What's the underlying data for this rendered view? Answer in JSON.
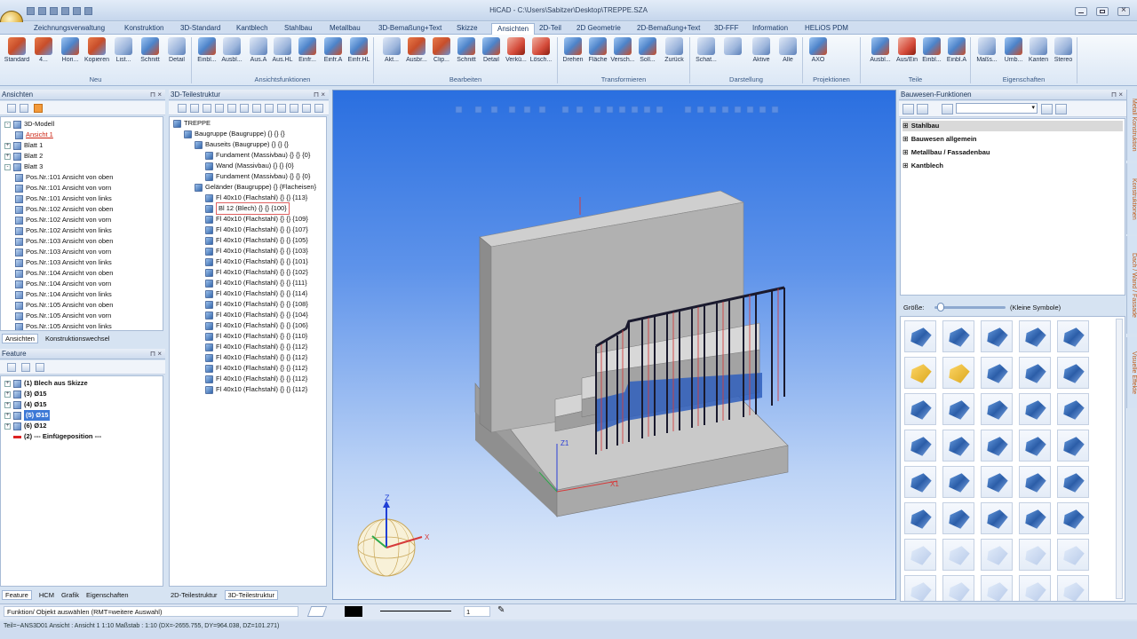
{
  "window": {
    "title": "HiCAD - C:\\Users\\Sabitzer\\Desktop\\TREPPE.SZA"
  },
  "tabs": [
    "Zeichnungsverwaltung",
    "Konstruktion",
    "3D-Standard",
    "Kantblech",
    "Stahlbau",
    "Metallbau",
    "3D-Bemaßung+Text",
    "Skizze",
    "Ansichten",
    "2D-Teil",
    "2D Geometrie",
    "2D-Bemaßung+Text",
    "3D-FFF",
    "Information",
    "HELiOS PDM"
  ],
  "ribbon": {
    "buttons": [
      "Standard",
      "4...",
      "Hori...",
      "Kopieren",
      "List...",
      "Schnitt",
      "Detail",
      "Einbl...",
      "Ausbl...",
      "Aus.A",
      "Aus.HL",
      "Einfr...",
      "Einfr.A",
      "Einfr.HL",
      "Akt...",
      "Ausbr...",
      "Clip...",
      "Schnitt",
      "Detail",
      "Verkü...",
      "Lösch...",
      "Drehen",
      "Fläche",
      "Versch...",
      "Soll...",
      "Zurück",
      "Schat...",
      "",
      "Aktive",
      "Alle",
      "AXO",
      "Ausbl...",
      "Aus/Ein",
      "Einbl...",
      "Einbl.A",
      "Maßs...",
      "Umb...",
      "Kanten",
      "Stereo"
    ],
    "groups": [
      "Neu",
      "Ansichtsfunktionen",
      "Bearbeiten",
      "Transformieren",
      "Darstellung",
      "Projektionen",
      "Teile",
      "Eigenschaften"
    ]
  },
  "ansichten": {
    "header": "Ansichten",
    "items": [
      {
        "label": "3D-Modell",
        "level": 0,
        "exp": "-"
      },
      {
        "label": "Ansicht 1",
        "level": 1,
        "exp": "",
        "style": "red"
      },
      {
        "label": "Blatt 1",
        "level": 0,
        "exp": "+"
      },
      {
        "label": "Blatt 2",
        "level": 0,
        "exp": "+"
      },
      {
        "label": "Blatt 3",
        "level": 0,
        "exp": "-"
      },
      {
        "label": "Pos.Nr.:101 Ansicht von oben",
        "level": 1,
        "exp": ""
      },
      {
        "label": "Pos.Nr.:101 Ansicht von vorn",
        "level": 1,
        "exp": ""
      },
      {
        "label": "Pos.Nr.:101 Ansicht von links",
        "level": 1,
        "exp": ""
      },
      {
        "label": "Pos.Nr.:102 Ansicht von oben",
        "level": 1,
        "exp": ""
      },
      {
        "label": "Pos.Nr.:102 Ansicht von vorn",
        "level": 1,
        "exp": ""
      },
      {
        "label": "Pos.Nr.:102 Ansicht von links",
        "level": 1,
        "exp": ""
      },
      {
        "label": "Pos.Nr.:103 Ansicht von oben",
        "level": 1,
        "exp": ""
      },
      {
        "label": "Pos.Nr.:103 Ansicht von vorn",
        "level": 1,
        "exp": ""
      },
      {
        "label": "Pos.Nr.:103 Ansicht von links",
        "level": 1,
        "exp": ""
      },
      {
        "label": "Pos.Nr.:104 Ansicht von oben",
        "level": 1,
        "exp": ""
      },
      {
        "label": "Pos.Nr.:104 Ansicht von vorn",
        "level": 1,
        "exp": ""
      },
      {
        "label": "Pos.Nr.:104 Ansicht von links",
        "level": 1,
        "exp": ""
      },
      {
        "label": "Pos.Nr.:105 Ansicht von oben",
        "level": 1,
        "exp": ""
      },
      {
        "label": "Pos.Nr.:105 Ansicht von vorn",
        "level": 1,
        "exp": ""
      },
      {
        "label": "Pos.Nr.:105 Ansicht von links",
        "level": 1,
        "exp": ""
      }
    ],
    "tabs": [
      "Ansichten",
      "Konstruktionswechsel"
    ]
  },
  "feature": {
    "header": "Feature",
    "items": [
      {
        "label": "(1) Blech aus Skizze",
        "hl": false
      },
      {
        "label": "(3) Ø15",
        "hl": false
      },
      {
        "label": "(4) Ø15",
        "hl": false
      },
      {
        "label": "(5) Ø15",
        "hl": true
      },
      {
        "label": "(6) Ø12",
        "hl": false
      },
      {
        "label": "(2) --- Einfügeposition ---",
        "hl": false
      }
    ],
    "tabs": [
      "Feature",
      "HCM",
      "Grafik",
      "Eigenschaften"
    ]
  },
  "teilestruktur": {
    "header": "3D-Teilestruktur",
    "items": [
      {
        "label": "TREPPE",
        "level": 0
      },
      {
        "label": "Baugruppe (Baugruppe) {} {} {}",
        "level": 1
      },
      {
        "label": "Bauseits (Baugruppe) {} {} {}",
        "level": 2
      },
      {
        "label": "Fundament (Massivbau) {} {} {0}",
        "level": 3
      },
      {
        "label": "Wand (Massivbau) {} {} {0}",
        "level": 3
      },
      {
        "label": "Fundament (Massivbau) {} {} {0}",
        "level": 3
      },
      {
        "label": "Geländer (Baugruppe) {} {Flacheisen}",
        "level": 2
      },
      {
        "label": "Fl 40x10 (Flachstahl) {} {} {113}",
        "level": 3
      },
      {
        "label": "Bl 12 (Blech) {} {} {100}",
        "level": 3,
        "style": "box"
      },
      {
        "label": "Fl 40x10 (Flachstahl) {} {} {109}",
        "level": 3
      },
      {
        "label": "Fl 40x10 (Flachstahl) {} {} {107}",
        "level": 3
      },
      {
        "label": "Fl 40x10 (Flachstahl) {} {} {105}",
        "level": 3
      },
      {
        "label": "Fl 40x10 (Flachstahl) {} {} {103}",
        "level": 3
      },
      {
        "label": "Fl 40x10 (Flachstahl) {} {} {101}",
        "level": 3
      },
      {
        "label": "Fl 40x10 (Flachstahl) {} {} {102}",
        "level": 3
      },
      {
        "label": "Fl 40x10 (Flachstahl) {} {} {111}",
        "level": 3
      },
      {
        "label": "Fl 40x10 (Flachstahl) {} {} {114}",
        "level": 3
      },
      {
        "label": "Fl 40x10 (Flachstahl) {} {} {108}",
        "level": 3
      },
      {
        "label": "Fl 40x10 (Flachstahl) {} {} {104}",
        "level": 3
      },
      {
        "label": "Fl 40x10 (Flachstahl) {} {} {106}",
        "level": 3
      },
      {
        "label": "Fl 40x10 (Flachstahl) {} {} {110}",
        "level": 3
      },
      {
        "label": "Fl 40x10 (Flachstahl) {} {} {112}",
        "level": 3
      },
      {
        "label": "Fl 40x10 (Flachstahl) {} {} {112}",
        "level": 3
      },
      {
        "label": "Fl 40x10 (Flachstahl) {} {} {112}",
        "level": 3
      },
      {
        "label": "Fl 40x10 (Flachstahl) {} {} {112}",
        "level": 3
      },
      {
        "label": "Fl 40x10 (Flachstahl) {} {} {112}",
        "level": 3
      }
    ],
    "tabs": [
      "2D-Teilestruktur",
      "3D-Teilestruktur"
    ]
  },
  "viewport": {
    "axis_z": "Z",
    "axis_x": "X",
    "label_z1": "Z1",
    "label_x1": "X1"
  },
  "bauwesen": {
    "header": "Bauwesen-Funktionen",
    "items": [
      "Stahlbau",
      "Bauwesen allgemein",
      "Metallbau / Fassadenbau",
      "Kantblech"
    ],
    "size_label": "Größe:",
    "size_value": "(Kleine Symbole)"
  },
  "sidetabs": [
    "Metall Konstruktion",
    "Konstruktionen",
    "Dach / Wand / Fassade",
    "Visuelle Effekte"
  ],
  "status": {
    "prompt": "Funktion/ Objekt auswählen (RMT=weitere Auswahl)",
    "page": "1",
    "line": "Teil=~ANS3D01   Ansicht : Ansicht 1 1:10   Maßstab : 1:10   (DX=-2655.755, DY=964.038, DZ=101.271)"
  },
  "colors": {
    "accent": "#3d79d6",
    "viewport_top": "#2a6fe0",
    "viewport_bottom": "#e8f0fb"
  }
}
